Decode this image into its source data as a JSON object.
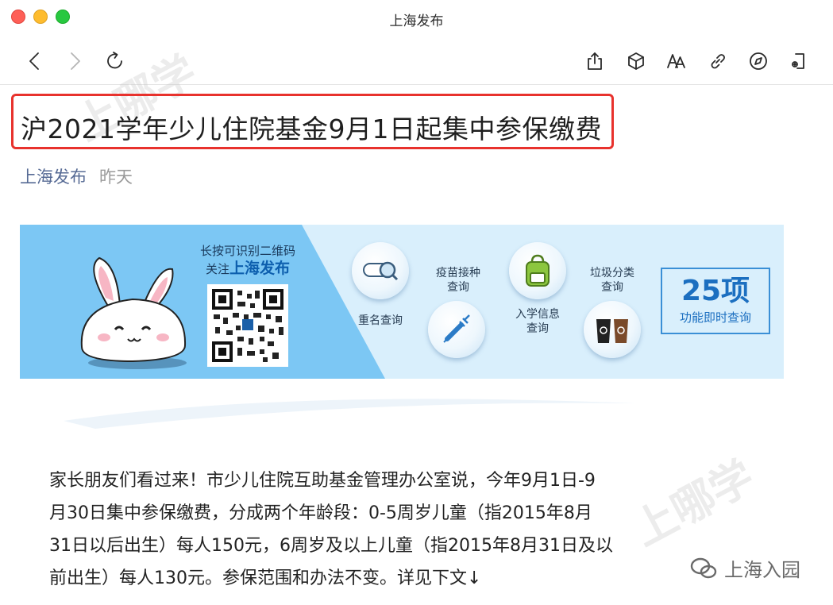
{
  "window": {
    "title": "上海发布"
  },
  "toolbar": {
    "buttons": [
      {
        "name": "back",
        "icon": "chevron-left-icon"
      },
      {
        "name": "forward",
        "icon": "chevron-right-icon"
      },
      {
        "name": "reload",
        "icon": "reload-icon"
      },
      {
        "name": "share",
        "icon": "share-icon"
      },
      {
        "name": "box",
        "icon": "cube-icon"
      },
      {
        "name": "text-size",
        "icon": "text-size-icon"
      },
      {
        "name": "copy-link",
        "icon": "link-icon"
      },
      {
        "name": "open-in-browser",
        "icon": "compass-icon"
      },
      {
        "name": "more",
        "icon": "mobile-options-icon"
      }
    ]
  },
  "article": {
    "title": "沪2021学年少儿住院基金9月1日起集中参保缴费",
    "source": "上海发布",
    "time": "昨天",
    "highlight_color": "#e8322d"
  },
  "banner": {
    "qr_caption_line1": "长按可识别二维码",
    "qr_caption_line2_prefix": "关注",
    "qr_caption_line2_accent": "上海发布",
    "features": {
      "rename": "重名查询",
      "vaccine_l1": "疫苗接种",
      "vaccine_l2": "查询",
      "school_l1": "入学信息",
      "school_l2": "查询",
      "garbage_l1": "垃圾分类",
      "garbage_l2": "查询"
    },
    "count_number": "25项",
    "count_text": "功能即时查询"
  },
  "body": {
    "lines": [
      "家长朋友们看过来！市少儿住院互助基金管理办公室说，今年9月1日-9",
      "月30日集中参保缴费，分成两个年龄段：0-5周岁儿童（指2015年8月",
      "31日以后出生）每人150元，6周岁及以上儿童（指2015年8月31日及以",
      "前出生）每人130元。参保范围和办法不变。详见下文↓"
    ]
  },
  "watermark": {
    "brand": "上海入园",
    "logo_text": "上哪学"
  },
  "colors": {
    "link": "#576b95",
    "muted": "#9a9a9a",
    "banner_blue": "#7cc7f4",
    "banner_light": "#d9effc"
  }
}
